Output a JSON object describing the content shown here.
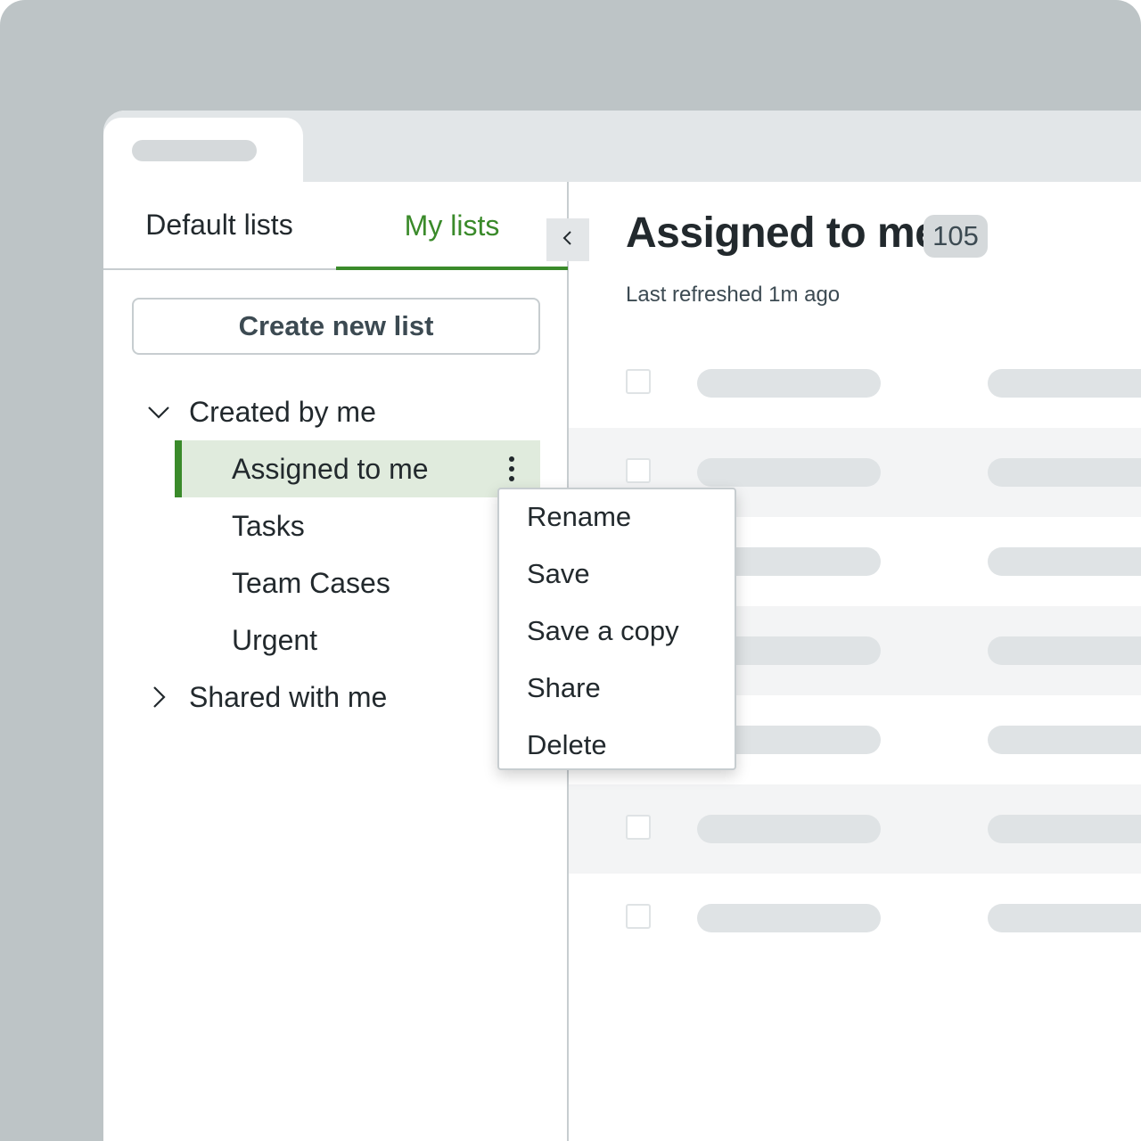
{
  "sidebar": {
    "tabs": [
      {
        "label": "Default lists",
        "active": false
      },
      {
        "label": "My lists",
        "active": true
      }
    ],
    "collapse_icon": "chevron-left-icon",
    "create_button_label": "Create new list",
    "groups": {
      "created": {
        "label": "Created by me",
        "expanded": true,
        "icon": "chevron-down-icon"
      },
      "shared": {
        "label": "Shared with me",
        "expanded": false,
        "icon": "chevron-right-icon"
      }
    },
    "lists": [
      {
        "label": "Assigned to me",
        "selected": true
      },
      {
        "label": "Tasks",
        "selected": false
      },
      {
        "label": "Team Cases",
        "selected": false
      },
      {
        "label": "Urgent",
        "selected": false
      }
    ],
    "more_icon": "kebab-menu-icon"
  },
  "main": {
    "title": "Assigned to me",
    "count": "105",
    "last_refreshed": "Last refreshed 1m ago"
  },
  "context_menu": {
    "items": [
      "Rename",
      "Save",
      "Save a copy",
      "Share",
      "Delete"
    ]
  },
  "colors": {
    "accent": "#3a8a2a",
    "selected_bg": "#e0ebdd",
    "backdrop": "#bdc4c6",
    "placeholder": "#dfe3e5"
  }
}
